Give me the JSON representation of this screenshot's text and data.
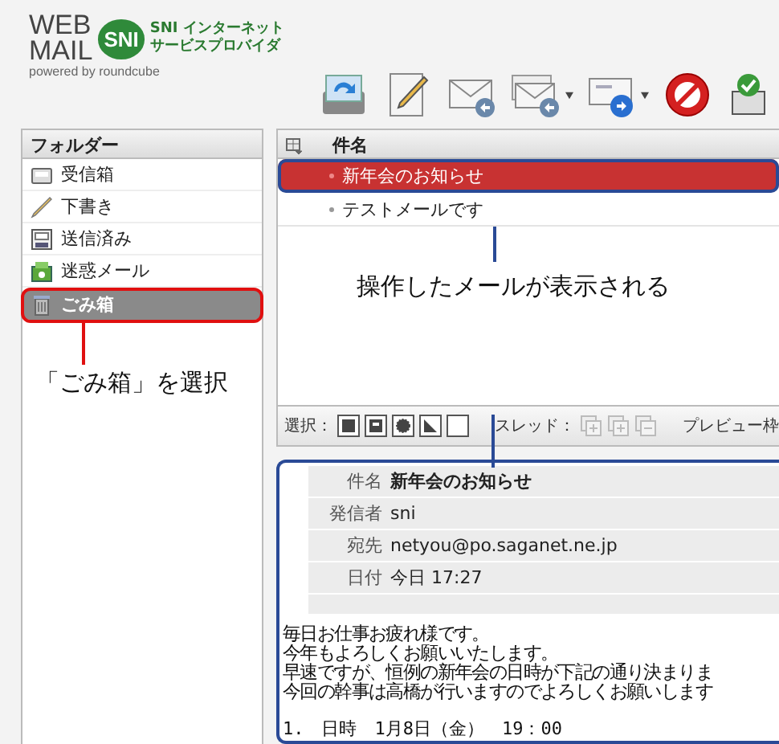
{
  "logo": {
    "word_top": "WEB",
    "word_bottom": "MAIL",
    "badge": "SNI",
    "company_lines": [
      "SNI インターネット",
      "サービスプロバイダ"
    ],
    "powered": "powered by roundcube"
  },
  "toolbar": [
    {
      "kind": "refresh",
      "dropdown": false
    },
    {
      "kind": "compose",
      "dropdown": false
    },
    {
      "kind": "reply",
      "dropdown": false
    },
    {
      "kind": "reply_all",
      "dropdown": true
    },
    {
      "kind": "forward",
      "dropdown": true
    },
    {
      "kind": "delete",
      "dropdown": false
    },
    {
      "kind": "spam",
      "dropdown": false
    }
  ],
  "folders": {
    "title": "フォルダー",
    "items": [
      {
        "label": "受信箱",
        "kind": "inbox",
        "selected": false
      },
      {
        "label": "下書き",
        "kind": "drafts",
        "selected": false
      },
      {
        "label": "送信済み",
        "kind": "sent",
        "selected": false
      },
      {
        "label": "迷惑メール",
        "kind": "junk",
        "selected": false
      },
      {
        "label": "ごみ箱",
        "kind": "trash",
        "selected": true
      }
    ],
    "callout": "「ごみ箱」を選択"
  },
  "message_list": {
    "column": "件名",
    "rows": [
      {
        "subject": "新年会のお知らせ",
        "selected": true
      },
      {
        "subject": "テストメールです",
        "selected": false
      }
    ],
    "callout": "操作したメールが表示される"
  },
  "list_toolbar": {
    "select_label": "選択：",
    "select_buttons": [
      {
        "kind": "all"
      },
      {
        "kind": "page"
      },
      {
        "kind": "unread"
      },
      {
        "kind": "flagged"
      },
      {
        "kind": "none"
      }
    ],
    "thread_label": "スレッド：",
    "thread_buttons": [
      {
        "kind": "expand"
      },
      {
        "kind": "expand_unread"
      },
      {
        "kind": "collapse"
      }
    ],
    "preview_label": "プレビュー枠"
  },
  "preview": {
    "headers": [
      {
        "label": "件名",
        "value": "新年会のお知らせ",
        "kind": "subject"
      },
      {
        "label": "発信者",
        "value": "sni",
        "kind": "plain"
      },
      {
        "label": "宛先",
        "value": "netyou@po.saganet.ne.jp",
        "kind": "plain"
      },
      {
        "label": "日付",
        "value": "今日 17:27",
        "kind": "plain"
      }
    ],
    "body": [
      "毎日お仕事お疲れ様です。",
      "今年もよろしくお願いいたします。",
      "早速ですが、恒例の新年会の日時が下記の通り決まりま",
      "今回の幹事は高橋が行いますのでよろしくお願いします"
    ],
    "list": [
      "1.　日時　1月8日（金）　19：00"
    ]
  }
}
